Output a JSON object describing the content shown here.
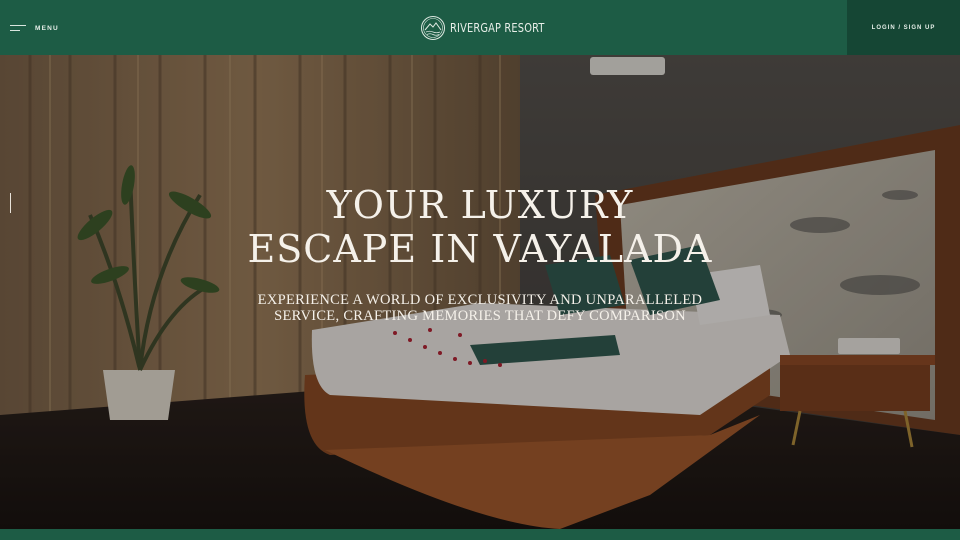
{
  "header": {
    "menu_label": "MENU",
    "logo_text": "RIVERGAP RESORT",
    "login_label": "LOGIN / SIGN UP",
    "menu_icon": "hamburger-icon",
    "logo_icon": "resort-logo-icon"
  },
  "hero": {
    "title_line1": "YOUR LUXURY",
    "title_line2": "ESCAPE IN VAYALADA",
    "subtitle_line1": "EXPERIENCE A WORLD OF EXCLUSIVITY AND UNPARALLELED",
    "subtitle_line2": "SERVICE, CRAFTING MEMORIES THAT DEFY COMPARISON",
    "slide_indicator_icon": "slide-indicator-line"
  },
  "colors": {
    "brand_green": "#1d5c45",
    "login_green": "#154634",
    "hero_text": "#f5f1ea"
  }
}
